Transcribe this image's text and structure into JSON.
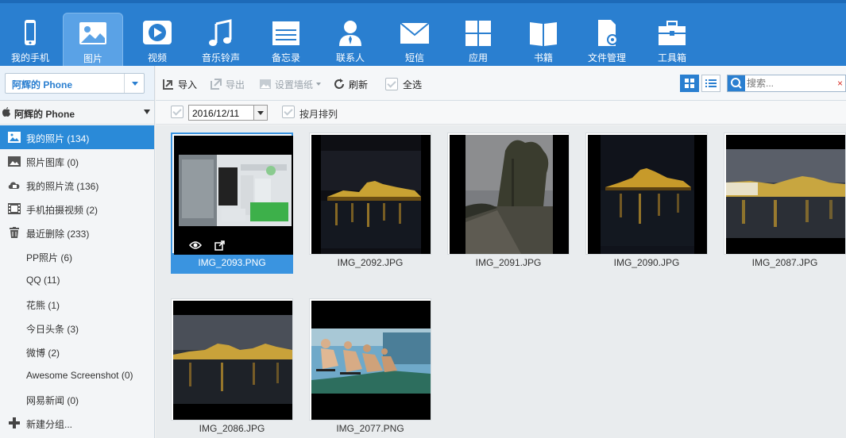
{
  "nav": {
    "items": [
      {
        "label": "我的手机",
        "icon": "phone-icon"
      },
      {
        "label": "图片",
        "icon": "picture-icon"
      },
      {
        "label": "视频",
        "icon": "video-play-icon"
      },
      {
        "label": "音乐铃声",
        "icon": "music-note-icon"
      },
      {
        "label": "备忘录",
        "icon": "memo-icon"
      },
      {
        "label": "联系人",
        "icon": "contact-icon"
      },
      {
        "label": "短信",
        "icon": "envelope-icon"
      },
      {
        "label": "应用",
        "icon": "apps-grid-icon"
      },
      {
        "label": "书籍",
        "icon": "book-icon"
      },
      {
        "label": "文件管理",
        "icon": "file-gear-icon"
      },
      {
        "label": "工具箱",
        "icon": "toolbox-icon"
      }
    ],
    "active_index": 1
  },
  "device": {
    "selector_label": "阿辉的 Phone"
  },
  "toolbar": {
    "import_label": "导入",
    "export_label": "导出",
    "wallpaper_label": "设置墙纸",
    "refresh_label": "刷新",
    "select_all_label": "全选",
    "search_placeholder": "搜索...",
    "search_clear": "×"
  },
  "sidebar": {
    "device_name": "阿辉的 Phone",
    "items": [
      {
        "label": "我的照片 (134)",
        "icon": "photo-icon",
        "active": true
      },
      {
        "label": "照片图库 (0)",
        "icon": "gallery-icon"
      },
      {
        "label": "我的照片流 (136)",
        "icon": "photostream-cloud-icon"
      },
      {
        "label": "手机拍摄视频 (2)",
        "icon": "film-icon"
      },
      {
        "label": "最近删除 (233)",
        "icon": "trash-icon"
      },
      {
        "label": "PP照片 (6)"
      },
      {
        "label": "QQ (11)"
      },
      {
        "label": "花熊 (1)"
      },
      {
        "label": "今日头条 (3)"
      },
      {
        "label": "微博 (2)"
      },
      {
        "label": "Awesome Screenshot (0)"
      },
      {
        "label": "网易新闻 (0)"
      },
      {
        "label": "新建分组...",
        "icon": "plus-icon"
      }
    ]
  },
  "filter": {
    "date_value": "2016/12/11",
    "by_month_label": "按月排列"
  },
  "photos": [
    {
      "name": "IMG_2093.PNG",
      "selected": true
    },
    {
      "name": "IMG_2092.JPG"
    },
    {
      "name": "IMG_2091.JPG"
    },
    {
      "name": "IMG_2090.JPG"
    },
    {
      "name": "IMG_2087.JPG"
    },
    {
      "name": "IMG_2086.JPG"
    },
    {
      "name": "IMG_2077.PNG"
    }
  ],
  "colors": {
    "accent": "#2a7fd0",
    "selected": "#3a94e0"
  }
}
